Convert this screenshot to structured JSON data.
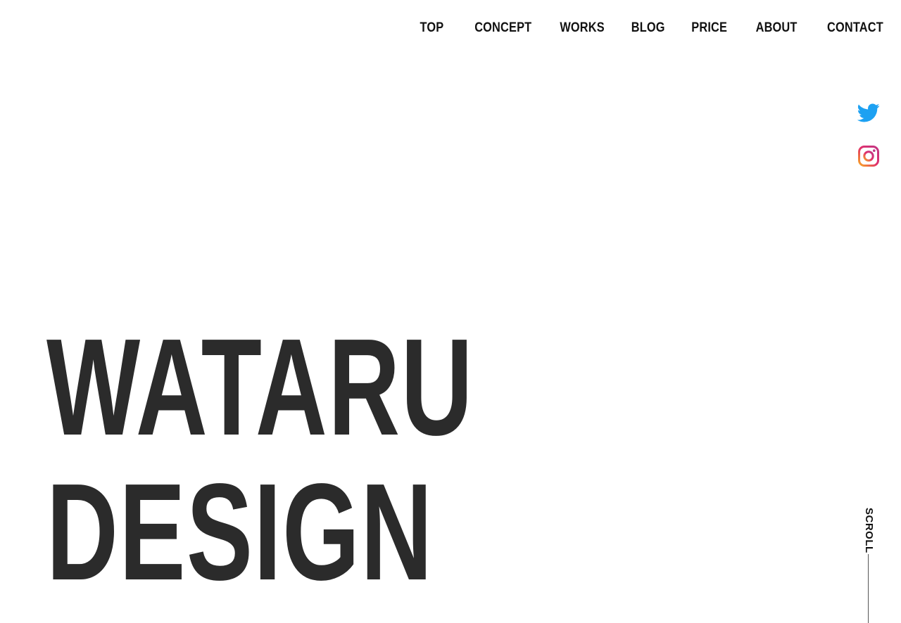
{
  "nav": {
    "items": [
      {
        "label": "TOP"
      },
      {
        "label": "CONCEPT"
      },
      {
        "label": "WORKS"
      },
      {
        "label": "BLOG"
      },
      {
        "label": "PRICE"
      },
      {
        "label": "ABOUT"
      },
      {
        "label": "CONTACT"
      }
    ]
  },
  "social": {
    "icons": [
      "twitter-icon",
      "instagram-icon"
    ],
    "twitter_color": "#1DA1F2",
    "instagram_colors": [
      "#F9A825",
      "#E1306C",
      "#C13584"
    ]
  },
  "hero": {
    "line1": "WATARU",
    "line2": "DESIGN",
    "color": "#2b2b2b"
  },
  "scroll": {
    "label": "SCROLL"
  }
}
